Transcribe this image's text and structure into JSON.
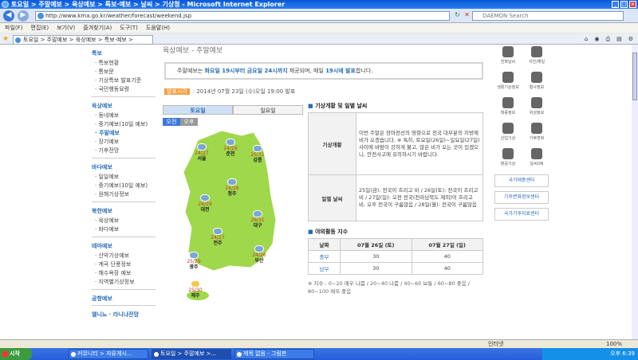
{
  "window": {
    "title": "토요일 > 주말예보 > 육상예보 > 특보·예보 > 날씨 > 기상청 - Microsoft Internet Explorer"
  },
  "address": {
    "url": "http://www.kma.go.kr/weather/forecast/weekend.jsp",
    "search_placeholder": "DAEMON Search"
  },
  "menu": [
    "파일(F)",
    "편집(E)",
    "보기(V)",
    "즐겨찾기(A)",
    "도구(T)",
    "도움말(H)"
  ],
  "tab": {
    "label": "토요일 > 주말예보 > 육상예보 > 특보·예보 >"
  },
  "page_header": "육상예보 - 주말예보",
  "left_nav": {
    "sections": [
      {
        "title": "특보",
        "items": [
          "특보현황",
          "통보문",
          "기상특보 발표기준",
          "국민행동요령"
        ]
      },
      {
        "title": "육상예보",
        "items": [
          "동네예보",
          "중기예보(10일 예보)",
          "주말예보",
          "장기예보",
          "기후전망"
        ]
      },
      {
        "title": "바다예보",
        "items": [
          "일일예보",
          "중기예보(10일 예보)",
          "원해기상정보"
        ]
      },
      {
        "title": "북한예보",
        "items": [
          "육상예보",
          "바다예보"
        ]
      },
      {
        "title": "테마예보",
        "items": [
          "산악기상예보",
          "계곡 단풍정보",
          "해수욕장 예보",
          "지역별기상정보"
        ]
      },
      {
        "title": "공항예보",
        "items": []
      },
      {
        "title": "엘니뇨 · 라니냐전망",
        "items": []
      }
    ]
  },
  "notice": {
    "pre": "주말예보는 ",
    "b1": "화요일 19시부터 금요일 24시까지",
    "mid": " 제공되며, 매일 ",
    "b2": "19시에 발표",
    "post": "합니다."
  },
  "pub": {
    "badge": "발표시각",
    "text": ": 2014년 07월 23일 (수)오일 19:00 발표"
  },
  "day_tabs": [
    "토요일",
    "일요일"
  ],
  "ampm": [
    "오전",
    "오후"
  ],
  "map_cities": [
    {
      "name": "서울",
      "temp": "24/27"
    },
    {
      "name": "춘천",
      "temp": "24/26"
    },
    {
      "name": "강릉",
      "temp": "25/31"
    },
    {
      "name": "청주",
      "temp": "24/28"
    },
    {
      "name": "대전",
      "temp": "24/29"
    },
    {
      "name": "대구",
      "temp": "26/31"
    },
    {
      "name": "전주",
      "temp": "24/27"
    },
    {
      "name": "광주",
      "temp": "25/29"
    },
    {
      "name": "부산",
      "temp": "24/26"
    },
    {
      "name": "제주",
      "temp": "25/30"
    }
  ],
  "weather_section": {
    "title": "기상개황 및 일별 날씨",
    "rows": [
      {
        "label": "기상개황",
        "text": "이번 주말은 장마전선의 영향으로 전국 대부분의 지방에 비가 오겠습니다. ※ 특히, 토요일(26일)~일요일(27일) 사이에 바람이 강하게 불고, 많은 비가 오는 곳이 있겠으니, 안전사고에 유의하시기 바랍니다."
      },
      {
        "label": "일별 날씨",
        "text": "25일(금): 전국이 흐리고 비 / 26일(토): 전국이 흐리고 비 / 27일(일): 오전 전국(전라남북도 제외)이 흐리고 비, 오후 전국이 구름많음 / 28일(월): 전국이 구름많음"
      }
    ]
  },
  "leisure_section": {
    "title": "야외활동 지수",
    "headers": [
      "날짜",
      "07월 26일 (토)",
      "07월 27일 (일)"
    ],
    "rows": [
      {
        "region": "중부",
        "v1": "30",
        "v2": "40"
      },
      {
        "region": "남부",
        "v1": "30",
        "v2": "40"
      }
    ],
    "legend": "※ 지수 : 0~20 매우 나쁨 / 20~40 나쁨 / 40~60 보통 / 60~80 좋음 / 80~100 매우 좋음"
  },
  "right_icons": [
    "전파날씨",
    "지진/해일",
    "생활기상정보",
    "황사정보",
    "태풍정보",
    "위성정보",
    "산업기상",
    "기후변화",
    "항공기상",
    "날씨ON"
  ],
  "right_banners": [
    "국가태풍센터",
    "기후변화정보센터",
    "국가기후자료센터"
  ],
  "status": {
    "left": "",
    "zone": "인터넷",
    "zoom": "100%"
  },
  "taskbar": {
    "start": "시작",
    "tasks": [
      "커뮤니티 > 자유게시...",
      "토요일 > 주말예보 >...",
      "제목 없음 - 그림판"
    ],
    "time": "오후 6:39"
  }
}
